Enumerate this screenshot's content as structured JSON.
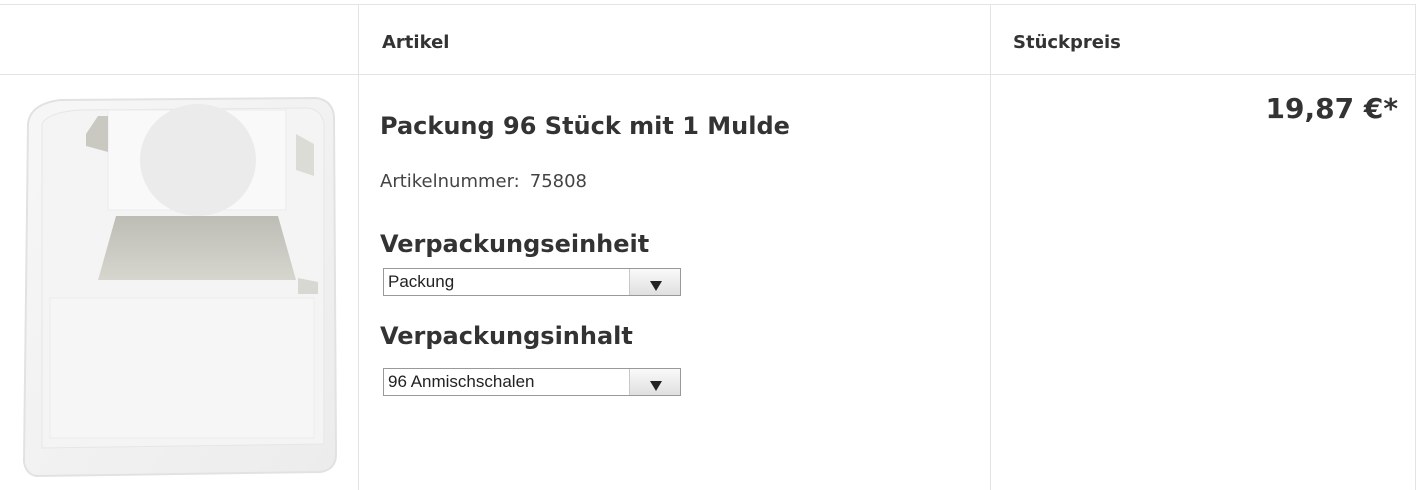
{
  "table": {
    "header": {
      "artikel": "Artikel",
      "stueckpreis": "Stückpreis"
    },
    "row": {
      "title": "Packung 96 Stück mit 1 Mulde",
      "artnr_label": "Artikelnummer:",
      "artnr_value": "75808",
      "verpackungseinheit_label": "Verpackungseinheit",
      "verpackungseinheit_value": "Packung",
      "verpackungsinhalt_label": "Verpackungsinhalt",
      "verpackungsinhalt_value": "96 Anmischschalen",
      "price": "19,87 €*"
    }
  },
  "icons": {
    "dropdown": "triangle-down-icon",
    "product_image": "mixing-tray-image"
  },
  "colors": {
    "text": "#333333",
    "border": "#e4e4e4",
    "select_border": "#999999"
  }
}
